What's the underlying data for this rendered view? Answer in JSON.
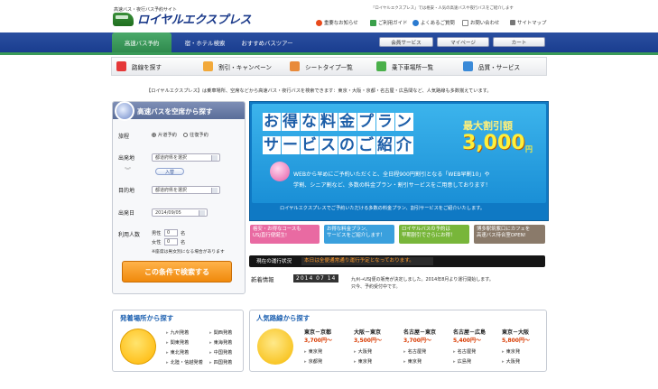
{
  "header": {
    "logo_small": "高速バス・夜行バス予約サイト",
    "logo_text": "ロイヤルエクスプレス",
    "tagline": "「ロイヤルエクスプレス」では格安・人気の高速バスや夜行バスをご紹介します",
    "links": [
      "重要なお知らせ",
      "ご利用ガイド",
      "よくあるご質問",
      "お問い合わせ",
      "サイトマップ"
    ]
  },
  "nav": {
    "tabs": [
      "高速バス予約",
      "宿・ホテル検索",
      "おすすめバスツアー"
    ],
    "buttons": [
      "会員サービス",
      "マイページ",
      "カート"
    ]
  },
  "categories": [
    "路線を探す",
    "割引・キャンペーン",
    "シートタイプ一覧",
    "乗下車場所一覧",
    "品質・サービス"
  ],
  "intro": "【ロイヤルエクスプレス】は乗車場所、空席などから高速バス・夜行バスを検索できます：東京・大阪・京都・名古屋・広島間など、人気路線も多数揃えています。",
  "search": {
    "title": "高速バスを空席から探す",
    "trip_label": "旅程",
    "oneway": "片道予約",
    "roundtrip": "往復予約",
    "from_label": "出発地",
    "from_value": "都道府県を選択",
    "swap": "入替",
    "to_label": "目的地",
    "to_value": "都道府県を選択",
    "date_label": "出発日",
    "date_value": "2014/09/05",
    "pax_label": "利用人数",
    "male": "男性",
    "female": "女性",
    "male_value": "0",
    "female_value": "0",
    "unit": "名",
    "note": "※座席は男女別になる場合があります",
    "submit": "この条件で検索する"
  },
  "banner": {
    "line1": [
      "お",
      "得",
      "な",
      "料",
      "金",
      "プ",
      "ラ",
      "ン"
    ],
    "line2": [
      "サ",
      "ー",
      "ビ",
      "ス",
      "の",
      "ご",
      "紹",
      "介"
    ],
    "max_label": "最大割引額",
    "amount": "3,000",
    "yen": "円",
    "desc1": "WEBから早めにご予約いただくと、全日程900円割引となる「WEB早割10」や",
    "desc2": "学割、シニア割など、多数の料金プラン・割引サービスをご用意しております！",
    "foot": "ロイヤルエクスプレスでご予約いただける多数の料金プラン、割引サービスをご紹介いたします。"
  },
  "mini_banners": [
    {
      "text": "格安・お得なコースも\nUSJ直行便誕生!",
      "color": "#e96aa2"
    },
    {
      "text": "お得な料金プラン、\nサービスをご紹介します！",
      "color": "#3aa0dd"
    },
    {
      "text": "ロイヤルバスの予約は\n早期割引でさらにお得！",
      "color": "#78b63a"
    },
    {
      "text": "博多駅筑紫口にカフェを\n高速バス待合室OPEN!",
      "color": "#8a7a6a"
    }
  ],
  "status": {
    "label": "現在の運行状況",
    "text": "本日は全便通常通り運行予定となっております。"
  },
  "news": {
    "label": "新着情報",
    "date": "2014 07 14",
    "line1": "九州→USJ便の販売が決定しました。2014年8月より運行開始します。",
    "line2": "只今、予約受付中です。"
  },
  "departures": {
    "title": "発着場所から探す",
    "items": [
      "九州発着",
      "関東発着",
      "東北発着",
      "北陸・信越発着",
      "関西発着",
      "東海発着",
      "中国発着",
      "四国発着"
    ]
  },
  "popular": {
    "title": "人気路線から探す",
    "routes": [
      {
        "route": "東京－京都",
        "price": "3,700円～",
        "links": [
          "東京発",
          "京都発"
        ]
      },
      {
        "route": "大阪－東京",
        "price": "3,500円～",
        "links": [
          "大阪発",
          "東京発"
        ]
      },
      {
        "route": "名古屋－東京",
        "price": "3,700円～",
        "links": [
          "名古屋発",
          "東京発"
        ]
      },
      {
        "route": "名古屋－広島",
        "price": "5,400円～",
        "links": [
          "名古屋発",
          "広島発"
        ]
      },
      {
        "route": "東京－大阪",
        "price": "5,800円～",
        "links": [
          "東京発",
          "大阪発"
        ]
      }
    ]
  },
  "colors": {
    "nav": "#1a3d8f",
    "accent_green": "#2f8a4d",
    "search_button": "#f0890c",
    "banner": "#1a8fd6"
  }
}
